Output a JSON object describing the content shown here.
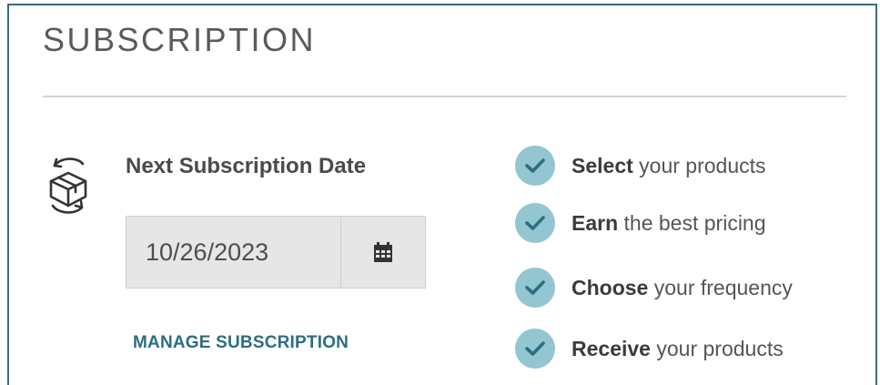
{
  "section": {
    "title": "SUBSCRIPTION"
  },
  "subscription": {
    "icon": "box-cycle-icon",
    "next_date_label": "Next Subscription Date",
    "date_value": "10/26/2023",
    "calendar_icon": "calendar-icon",
    "manage_link_label": "MANAGE SUBSCRIPTION",
    "link_color": "#2d6e82"
  },
  "benefits": [
    {
      "bold": "Select",
      "rest": "your products"
    },
    {
      "bold": "Earn",
      "rest": "the best pricing"
    },
    {
      "bold": "Choose",
      "rest": "your frequency"
    },
    {
      "bold": "Receive",
      "rest": "your products"
    }
  ],
  "colors": {
    "border": "#2f6f84",
    "check_circle": "#93c6d1",
    "check_mark": "#2d6e82",
    "input_bg": "#e6e6e6"
  }
}
